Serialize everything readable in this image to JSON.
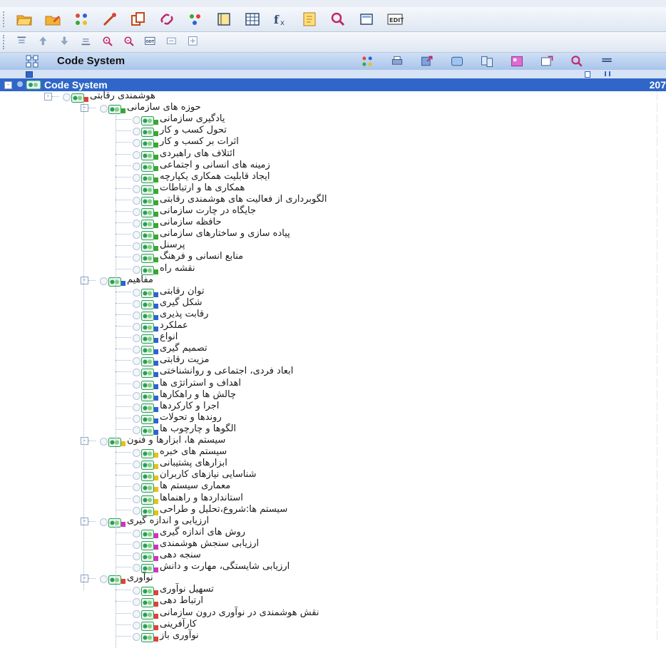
{
  "app": {
    "panel_title": "Code System",
    "root_label": "Code System",
    "root_count": "207"
  },
  "toolbar1": {
    "icons": [
      "folder-open-icon",
      "folder-edit-icon",
      "codes-icon",
      "wand-icon",
      "copy-icon",
      "link-icon",
      "memo-link-icon",
      "book-icon",
      "table-icon",
      "function-icon",
      "note-icon",
      "search-icon",
      "frame-icon",
      "edit-icon"
    ]
  },
  "toolbar2": {
    "icons": [
      "align-top-icon",
      "arrow-up-icon",
      "arrow-down-icon",
      "align-bottom-icon",
      "zoom-in-icon",
      "zoom-out-icon",
      "odt-icon",
      "collapse-icon",
      "expand-icon"
    ]
  },
  "panel_toolbar": {
    "icons": [
      "codes-icon",
      "print-icon",
      "export-icon",
      "layers-icon",
      "compare-icon",
      "color-icon",
      "new-window-icon",
      "search-icon",
      "menu-icon"
    ]
  },
  "tree": [
    {
      "label": "هوشمندی رقابتی",
      "level": 1,
      "expander": "-",
      "color": "red"
    },
    {
      "label": "حوزه های سازمانی",
      "level": 2,
      "expander": "-",
      "color": "green"
    },
    {
      "label": "یادگیری سازمانی",
      "level": 3,
      "color": "green"
    },
    {
      "label": "تحول کسب و کار",
      "level": 3,
      "color": "green"
    },
    {
      "label": "اثرات بر کسب و کار",
      "level": 3,
      "color": "green"
    },
    {
      "label": "ائتلاف های راهبردی",
      "level": 3,
      "color": "green"
    },
    {
      "label": "زمینه های انسانی و اجتماعی",
      "level": 3,
      "color": "green"
    },
    {
      "label": "ایجاد قابلیت همکاری یکپارچه",
      "level": 3,
      "color": "green"
    },
    {
      "label": "همکاری ها و ارتباطات",
      "level": 3,
      "color": "green"
    },
    {
      "label": "الگوبرداری از فعالیت های هوشمندی رقابتی",
      "level": 3,
      "color": "green"
    },
    {
      "label": "جایگاه در چارت سازمانی",
      "level": 3,
      "color": "green"
    },
    {
      "label": "حافظه سازمانی",
      "level": 3,
      "color": "green"
    },
    {
      "label": "پیاده سازی و ساختارهای سازمانی",
      "level": 3,
      "color": "green"
    },
    {
      "label": "پرسنل",
      "level": 3,
      "color": "green"
    },
    {
      "label": "منابع انسانی و فرهنگ",
      "level": 3,
      "color": "green"
    },
    {
      "label": "نقشه راه",
      "level": 3,
      "color": "green"
    },
    {
      "label": "مفاهیم",
      "level": 2,
      "expander": "-",
      "color": "blue"
    },
    {
      "label": "توان رقابتی",
      "level": 3,
      "color": "blue"
    },
    {
      "label": "شکل گیری",
      "level": 3,
      "color": "blue"
    },
    {
      "label": "رقابت پذیری",
      "level": 3,
      "color": "blue"
    },
    {
      "label": "عملکرد",
      "level": 3,
      "color": "blue"
    },
    {
      "label": "انواع",
      "level": 3,
      "color": "blue"
    },
    {
      "label": "تصمیم گیری",
      "level": 3,
      "color": "blue"
    },
    {
      "label": "مزیت رقابتی",
      "level": 3,
      "color": "blue"
    },
    {
      "label": "ابعاد فردی، اجتماعی و روانشناختی",
      "level": 3,
      "color": "blue"
    },
    {
      "label": "اهداف و استراتژی ها",
      "level": 3,
      "color": "blue"
    },
    {
      "label": "چالش ها و راهکارها",
      "level": 3,
      "color": "blue"
    },
    {
      "label": "اجرا و کارکردها",
      "level": 3,
      "color": "blue"
    },
    {
      "label": "روندها و تحولات",
      "level": 3,
      "color": "blue"
    },
    {
      "label": "الگوها و چارچوب ها",
      "level": 3,
      "color": "blue"
    },
    {
      "label": "سیستم ها، ابزارها و فنون",
      "level": 2,
      "expander": "-",
      "color": "yellow"
    },
    {
      "label": "سیستم های خبره",
      "level": 3,
      "color": "yellow"
    },
    {
      "label": "ابزارهای پشتیبانی",
      "level": 3,
      "color": "yellow"
    },
    {
      "label": "شناسایی نیازهای کاربران",
      "level": 3,
      "color": "yellow"
    },
    {
      "label": "معماری سیستم ها",
      "level": 3,
      "color": "yellow"
    },
    {
      "label": "استانداردها و راهنماها",
      "level": 3,
      "color": "yellow"
    },
    {
      "label": "سیستم ها:شروع،تحلیل و طراحی",
      "level": 3,
      "color": "yellow"
    },
    {
      "label": "ارزیابی و اندازه گیری",
      "level": 2,
      "expander": "-",
      "color": "magenta"
    },
    {
      "label": "روش های اندازه گیری",
      "level": 3,
      "color": "magenta"
    },
    {
      "label": "ارزیابی سنجش هوشمندی",
      "level": 3,
      "color": "magenta"
    },
    {
      "label": "سنجه دهی",
      "level": 3,
      "color": "magenta"
    },
    {
      "label": "ارزیابی شایستگی، مهارت و دانش",
      "level": 3,
      "color": "magenta"
    },
    {
      "label": "نوآوری",
      "level": 2,
      "expander": "-",
      "color": "red"
    },
    {
      "label": "تسهیل نوآوری",
      "level": 3,
      "color": "red"
    },
    {
      "label": "ارتباط دهی",
      "level": 3,
      "color": "red"
    },
    {
      "label": "نقش هوشمندی در نوآوری درون سازمانی",
      "level": 3,
      "color": "red"
    },
    {
      "label": "کارآفرینی",
      "level": 3,
      "color": "red"
    },
    {
      "label": "نوآوری باز",
      "level": 3,
      "color": "red"
    }
  ],
  "colors": {
    "red": "#e0413c",
    "green": "#3aa832",
    "blue": "#2e63d6",
    "yellow": "#e5c21b",
    "magenta": "#d52fc4",
    "root_bar": "#2f66c8"
  }
}
